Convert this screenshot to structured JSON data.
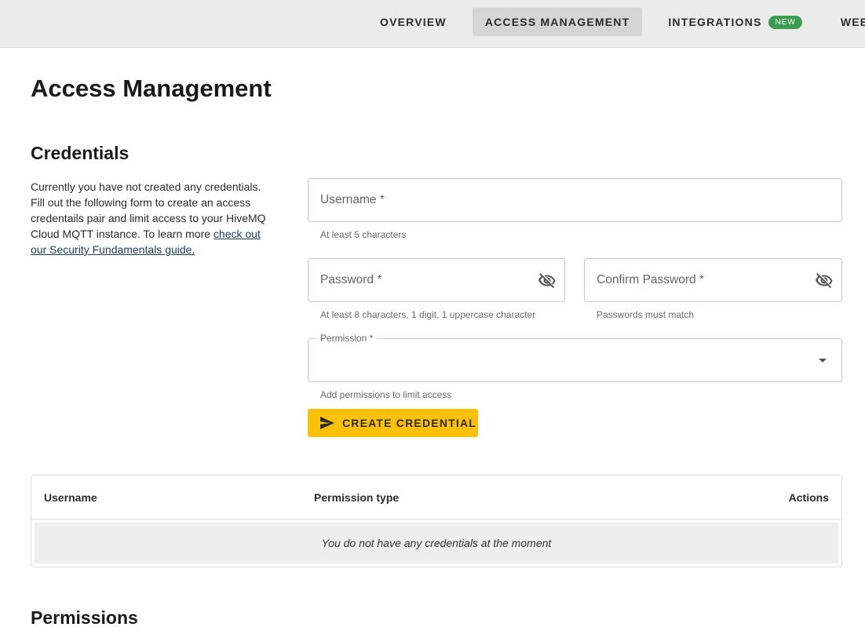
{
  "nav": {
    "tabs": [
      {
        "label": "OVERVIEW"
      },
      {
        "label": "ACCESS MANAGEMENT",
        "active": true
      },
      {
        "label": "INTEGRATIONS",
        "badge": "NEW"
      },
      {
        "label": "WEB CLIENT"
      }
    ]
  },
  "page": {
    "title": "Access Management"
  },
  "credentials": {
    "title": "Credentials",
    "intro": "Currently you have not created any credentials. Fill out the following form to create an access credentails pair and limit access to your HiveMQ Cloud MQTT instance. To learn more",
    "link_text": "check out our Security Fundamentals guide.",
    "form": {
      "username": {
        "label": "Username *",
        "helper": "At least 5 characters"
      },
      "password": {
        "label": "Password *",
        "helper": "At least 8 characters, 1 digit, 1 uppercase character",
        "icon": "visibility-off-icon"
      },
      "confirm_password": {
        "label": "Confirm Password *",
        "helper": "Passwords must match",
        "icon": "visibility-off-icon"
      },
      "permission": {
        "label": "Permission *",
        "helper": "Add permissions to limit access",
        "value": ""
      },
      "submit_label": "CREATE CREDENTIAL",
      "submit_icon": "send-icon",
      "accent_color": "#fcc106"
    },
    "table": {
      "headers": {
        "username": "Username",
        "permission_type": "Permission type",
        "actions": "Actions"
      },
      "empty_message": "You do not have any credentials at the moment"
    }
  },
  "permissions": {
    "title": "Permissions"
  }
}
